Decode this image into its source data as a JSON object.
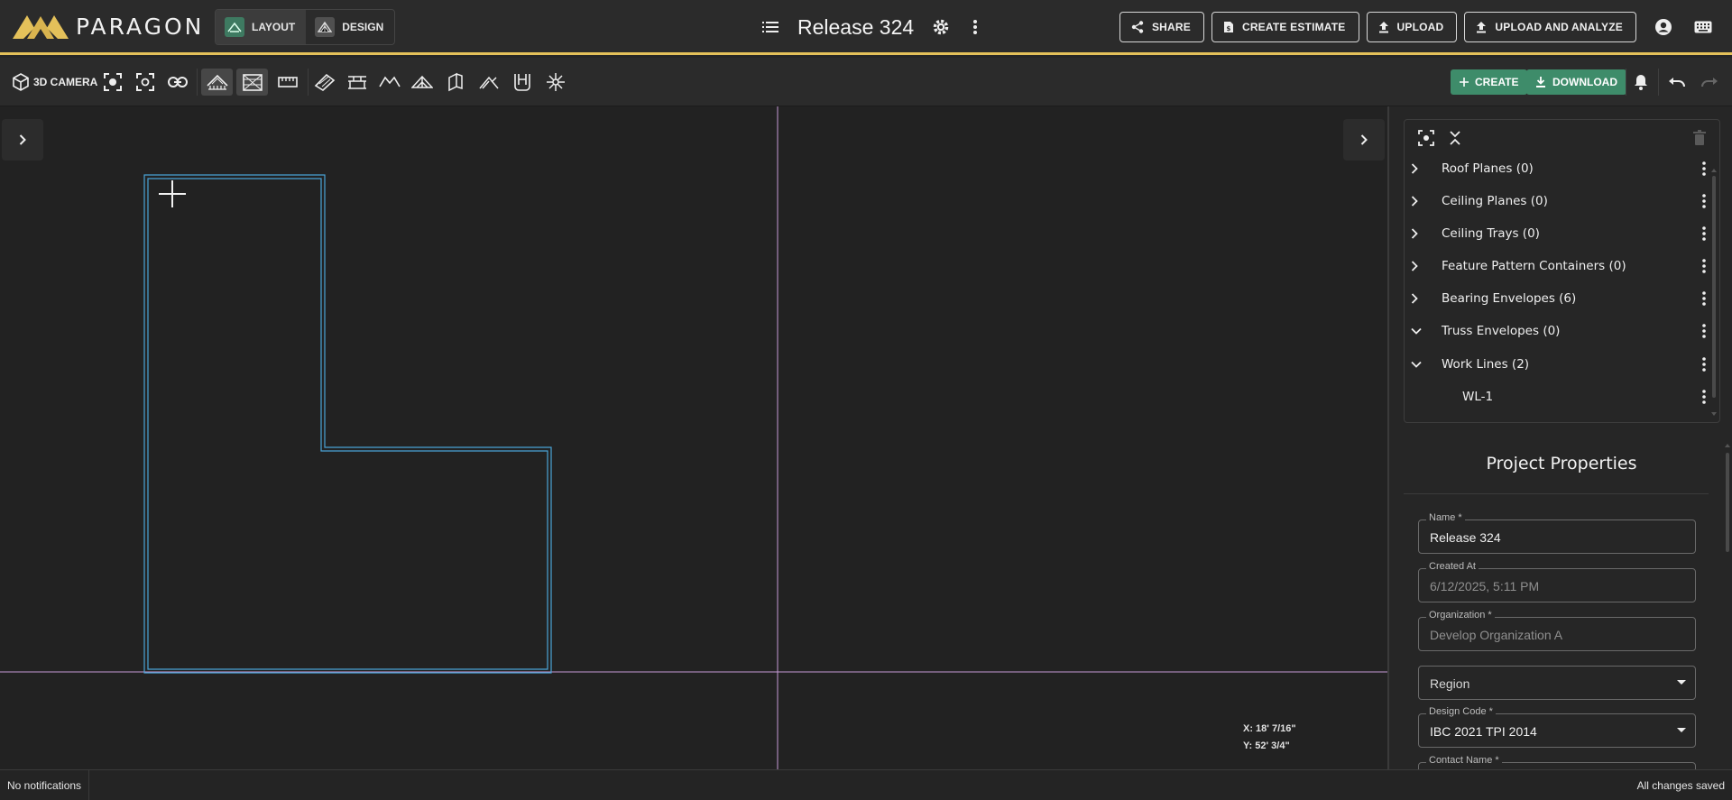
{
  "app": {
    "brand": "PARAGON",
    "accent_color": "#e4c15a",
    "modes": [
      {
        "label": "LAYOUT",
        "active": true
      },
      {
        "label": "DESIGN",
        "active": false
      }
    ],
    "project_title": "Release 324"
  },
  "header_actions": {
    "share": "SHARE",
    "create_estimate": "CREATE ESTIMATE",
    "upload": "UPLOAD",
    "upload_analyze": "UPLOAD AND ANALYZE"
  },
  "toolbar": {
    "camera_label": "3D CAMERA",
    "create_label": "CREATE",
    "download_label": "DOWNLOAD",
    "create_color": "#3e8c6a"
  },
  "canvas": {
    "coord_x": "X: 18' 7/16\"",
    "coord_y": "Y: 52' 3/4\"",
    "outline_color": "#4aa3d6",
    "axis_color": "#c79bd6"
  },
  "tree": {
    "items": [
      {
        "label": "Roof Planes (0)",
        "expanded": false
      },
      {
        "label": "Ceiling Planes (0)",
        "expanded": false
      },
      {
        "label": "Ceiling Trays (0)",
        "expanded": false
      },
      {
        "label": "Feature Pattern Containers (0)",
        "expanded": false
      },
      {
        "label": "Bearing Envelopes (6)",
        "expanded": false
      },
      {
        "label": "Truss Envelopes (0)",
        "expanded": true
      },
      {
        "label": "Work Lines (2)",
        "expanded": true
      }
    ],
    "child": "WL-1"
  },
  "properties": {
    "title": "Project Properties",
    "name_label": "Name *",
    "name_value": "Release 324",
    "created_label": "Created At",
    "created_value": "6/12/2025, 5:11 PM",
    "org_label": "Organization *",
    "org_value": "Develop Organization A",
    "region_placeholder": "Region",
    "design_code_label": "Design Code *",
    "design_code_value": "IBC 2021 TPI 2014",
    "contact_label": "Contact Name *"
  },
  "status": {
    "left": "No notifications",
    "right": "All changes saved"
  }
}
